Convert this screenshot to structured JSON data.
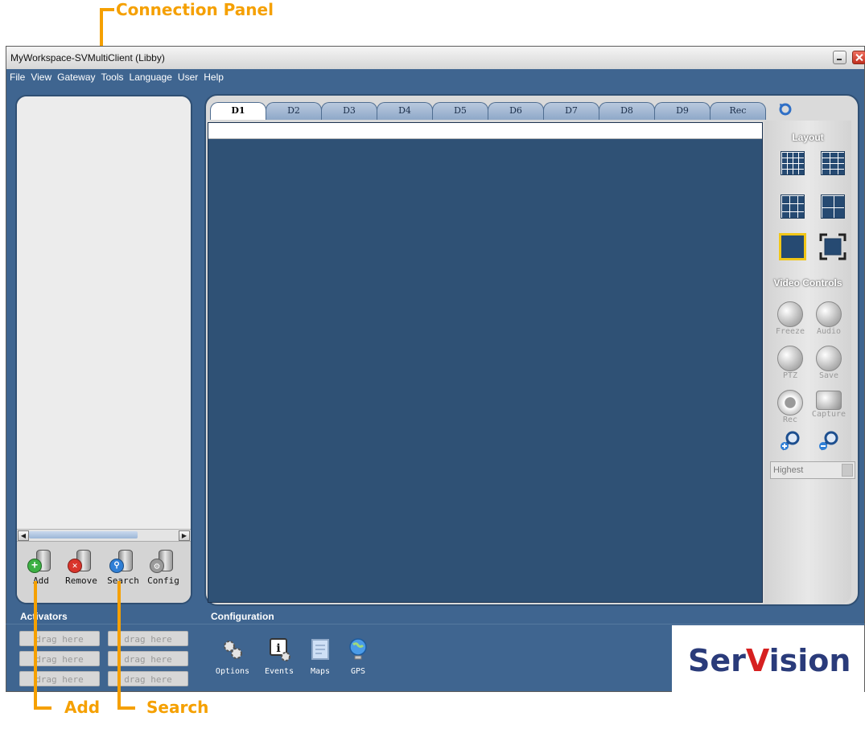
{
  "callouts": {
    "connection_panel": "Connection Panel",
    "add": "Add",
    "search": "Search"
  },
  "window": {
    "title": "MyWorkspace-SVMultiClient (Libby)"
  },
  "menu": [
    "File",
    "View",
    "Gateway",
    "Tools",
    "Language",
    "User",
    "Help"
  ],
  "connection_toolbar": [
    {
      "label": "Add",
      "icon": "add-server-icon"
    },
    {
      "label": "Remove",
      "icon": "remove-server-icon"
    },
    {
      "label": "Search",
      "icon": "search-server-icon"
    },
    {
      "label": "Config",
      "icon": "config-server-icon"
    }
  ],
  "activators": {
    "title": "Activators",
    "slots": [
      "drag here",
      "drag here",
      "drag here",
      "drag here",
      "drag here",
      "drag here"
    ]
  },
  "tabs": [
    "D1",
    "D2",
    "D3",
    "D4",
    "D5",
    "D6",
    "D7",
    "D8",
    "D9",
    "Rec"
  ],
  "active_tab": "D1",
  "sidebar": {
    "layout_title": "Layout",
    "video_controls_title": "Video Controls",
    "controls": [
      {
        "label": "Freeze",
        "icon": "freeze-icon"
      },
      {
        "label": "Audio",
        "icon": "audio-icon"
      },
      {
        "label": "PTZ",
        "icon": "ptz-icon"
      },
      {
        "label": "Save",
        "icon": "save-icon"
      },
      {
        "label": "Rec",
        "icon": "record-icon"
      },
      {
        "label": "Capture",
        "icon": "capture-icon"
      }
    ],
    "quality": "Highest"
  },
  "configuration": {
    "title": "Configuration",
    "items": [
      {
        "label": "Options",
        "icon": "options-gears-icon"
      },
      {
        "label": "Events",
        "icon": "events-info-icon"
      },
      {
        "label": "Maps",
        "icon": "maps-icon"
      },
      {
        "label": "GPS",
        "icon": "gps-globe-icon"
      }
    ]
  },
  "brand": {
    "part1": "Ser",
    "part2": "V",
    "part3": "ision"
  },
  "colors": {
    "callout": "#f5a000",
    "window_bg": "#3f6590",
    "video_bg": "#2f5175",
    "brand_navy": "#2a3b7a",
    "brand_red": "#d62020"
  }
}
